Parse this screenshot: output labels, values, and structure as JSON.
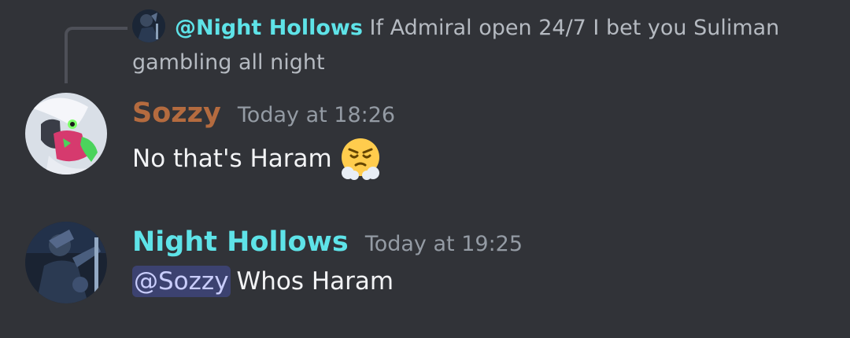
{
  "reply": {
    "mention": "@Night Hollows",
    "text": "If Admiral open 24/7 I bet you Suliman gambling all night",
    "avatar_icon": "night-hollows-avatar"
  },
  "messages": [
    {
      "author": "Sozzy",
      "author_color": "#b46b3f",
      "timestamp": "Today at 18:26",
      "text": "No that's Haram",
      "emoji_icon": "face-with-steam-from-nose",
      "avatar_icon": "sozzy-avatar"
    },
    {
      "author": "Night Hollows",
      "author_color": "#5ee3e8",
      "timestamp": "Today at 19:25",
      "mention": "@Sozzy",
      "text": "Whos Haram",
      "avatar_icon": "night-hollows-avatar"
    }
  ],
  "colors": {
    "background": "#313338",
    "mention_bg": "#3c4270",
    "mention_text": "#c9cdfb",
    "reply_mention": "#5ee3e8"
  }
}
